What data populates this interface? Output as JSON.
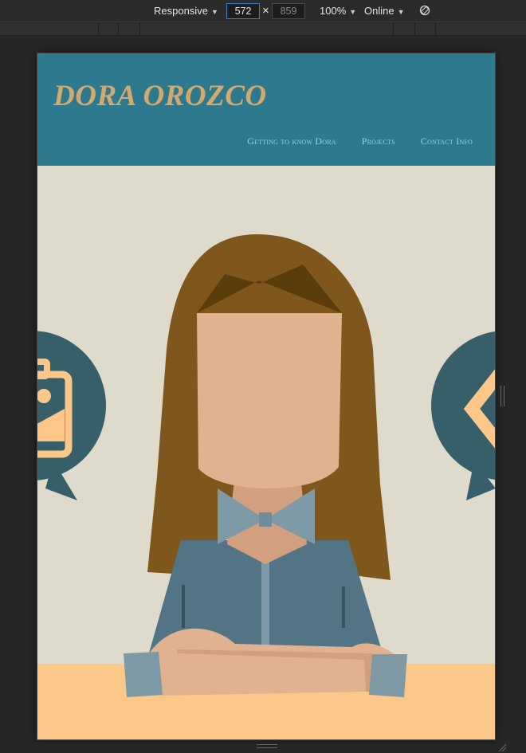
{
  "devtools": {
    "device_mode": "Responsive",
    "width": "572",
    "height": "859",
    "zoom": "100%",
    "throttling": "Online",
    "icons": {
      "rotate": "rotate-icon",
      "caret": "chevron-down-icon"
    }
  },
  "site": {
    "title": "DORA OROZCO",
    "nav": [
      {
        "label": "Getting to know Dora"
      },
      {
        "label": "Projects"
      },
      {
        "label": "Contact Info"
      }
    ]
  },
  "hero": {
    "illustration": "woman-with-crossed-arms",
    "left_bubble_icon": "photo-id-icon",
    "right_bubble_icon": "code-icon"
  },
  "colors": {
    "header_bg": "#2d7a8e",
    "title": "#d4a970",
    "nav_link": "#8fd3e0",
    "hero_bg": "#dedbcc",
    "table": "#fec78a",
    "bubble": "#365f6a",
    "hair": "#7f571c",
    "skin": "#e1b28f",
    "shirt": "#527485"
  }
}
